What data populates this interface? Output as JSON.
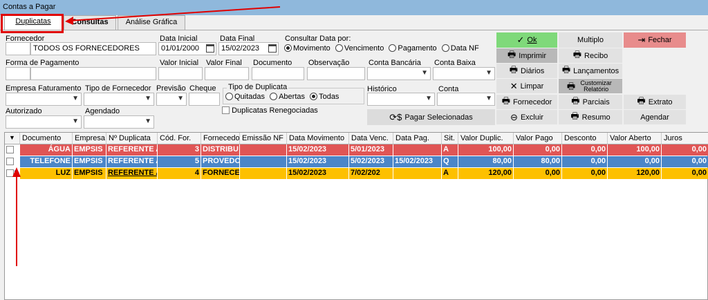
{
  "window": {
    "title": "Contas a Pagar"
  },
  "tabs": [
    {
      "label": "Duplicatas"
    },
    {
      "label": "Consultas"
    },
    {
      "label": "Análise Gráfica"
    }
  ],
  "filters": {
    "fornecedor_label": "Fornecedor",
    "fornecedor_value": "TODOS OS FORNECEDORES",
    "data_inicial_label": "Data Inicial",
    "data_inicial_value": "01/01/2000",
    "data_final_label": "Data Final",
    "data_final_value": "15/02/2023",
    "consultar_label": "Consultar Data por:",
    "consultar_options": [
      "Movimento",
      "Vencimento",
      "Pagamento",
      "Data NF"
    ],
    "forma_pagamento_label": "Forma de Pagamento",
    "valor_inicial_label": "Valor Inicial",
    "valor_final_label": "Valor Final",
    "documento_label": "Documento",
    "observacao_label": "Observação",
    "conta_bancaria_label": "Conta Bancária",
    "conta_baixa_label": "Conta Baixa",
    "empresa_faturamento_label": "Empresa Faturamento",
    "tipo_fornecedor_label": "Tipo de Fornecedor",
    "previsao_label": "Previsão",
    "cheque_label": "Cheque",
    "tipo_duplicata_label": "Tipo de Duplicata",
    "tipo_duplicata_options": [
      "Quitadas",
      "Abertas",
      "Todas"
    ],
    "historico_label": "Histórico",
    "conta_label": "Conta",
    "autorizado_label": "Autorizado",
    "agendado_label": "Agendado",
    "renegociadas_label": "Duplicatas Renegociadas"
  },
  "actions": {
    "ok": "Ok",
    "multiplo": "Multiplo",
    "fechar": "Fechar",
    "imprimir": "Imprimir",
    "recibo": "Recibo",
    "diarios": "Diários",
    "lancamentos": "Lançamentos",
    "limpar": "Limpar",
    "customizar": "Customizar Relatório",
    "fornecedor": "Fornecedor",
    "parciais": "Parciais",
    "extrato": "Extrato",
    "pagar_selecionadas": "Pagar Selecionadas",
    "excluir": "Excluir",
    "resumo": "Resumo",
    "agendar": "Agendar"
  },
  "table": {
    "headers": [
      "Documento",
      "Empresa",
      "Nº Duplicata",
      "Cód. For.",
      "Fornecedor",
      "Emissão NF",
      "Data Movimento",
      "Data Venc.",
      "Data Pag.",
      "Sit.",
      "Valor Duplic.",
      "Valor Pago",
      "Desconto",
      "Valor Aberto",
      "Juros"
    ],
    "rows": [
      [
        "ÁGUA",
        "EMPSIS",
        "REFERENTE A",
        "3",
        "DISTRIBU",
        "",
        "15/02/2023",
        "5/01/2023",
        "",
        "A",
        "100,00",
        "0,00",
        "0,00",
        "100,00",
        "0,00"
      ],
      [
        "TELEFONE",
        "EMPSIS",
        "REFERENTE A",
        "5",
        "PROVEDOR",
        "",
        "15/02/2023",
        "5/02/2023",
        "15/02/2023",
        "Q",
        "80,00",
        "80,00",
        "0,00",
        "0,00",
        "0,00"
      ],
      [
        "LUZ",
        "EMPSIS",
        "REFERENTE A",
        "4",
        "FORNECE",
        "",
        "15/02/2023",
        "7/02/202",
        "",
        "A",
        "120,00",
        "0,00",
        "0,00",
        "120,00",
        "0,00"
      ]
    ]
  },
  "colors": {
    "row_open": "#e05555",
    "row_paid": "#4b86c8",
    "row_selected": "#fdc000",
    "annotation": "#e00000"
  }
}
